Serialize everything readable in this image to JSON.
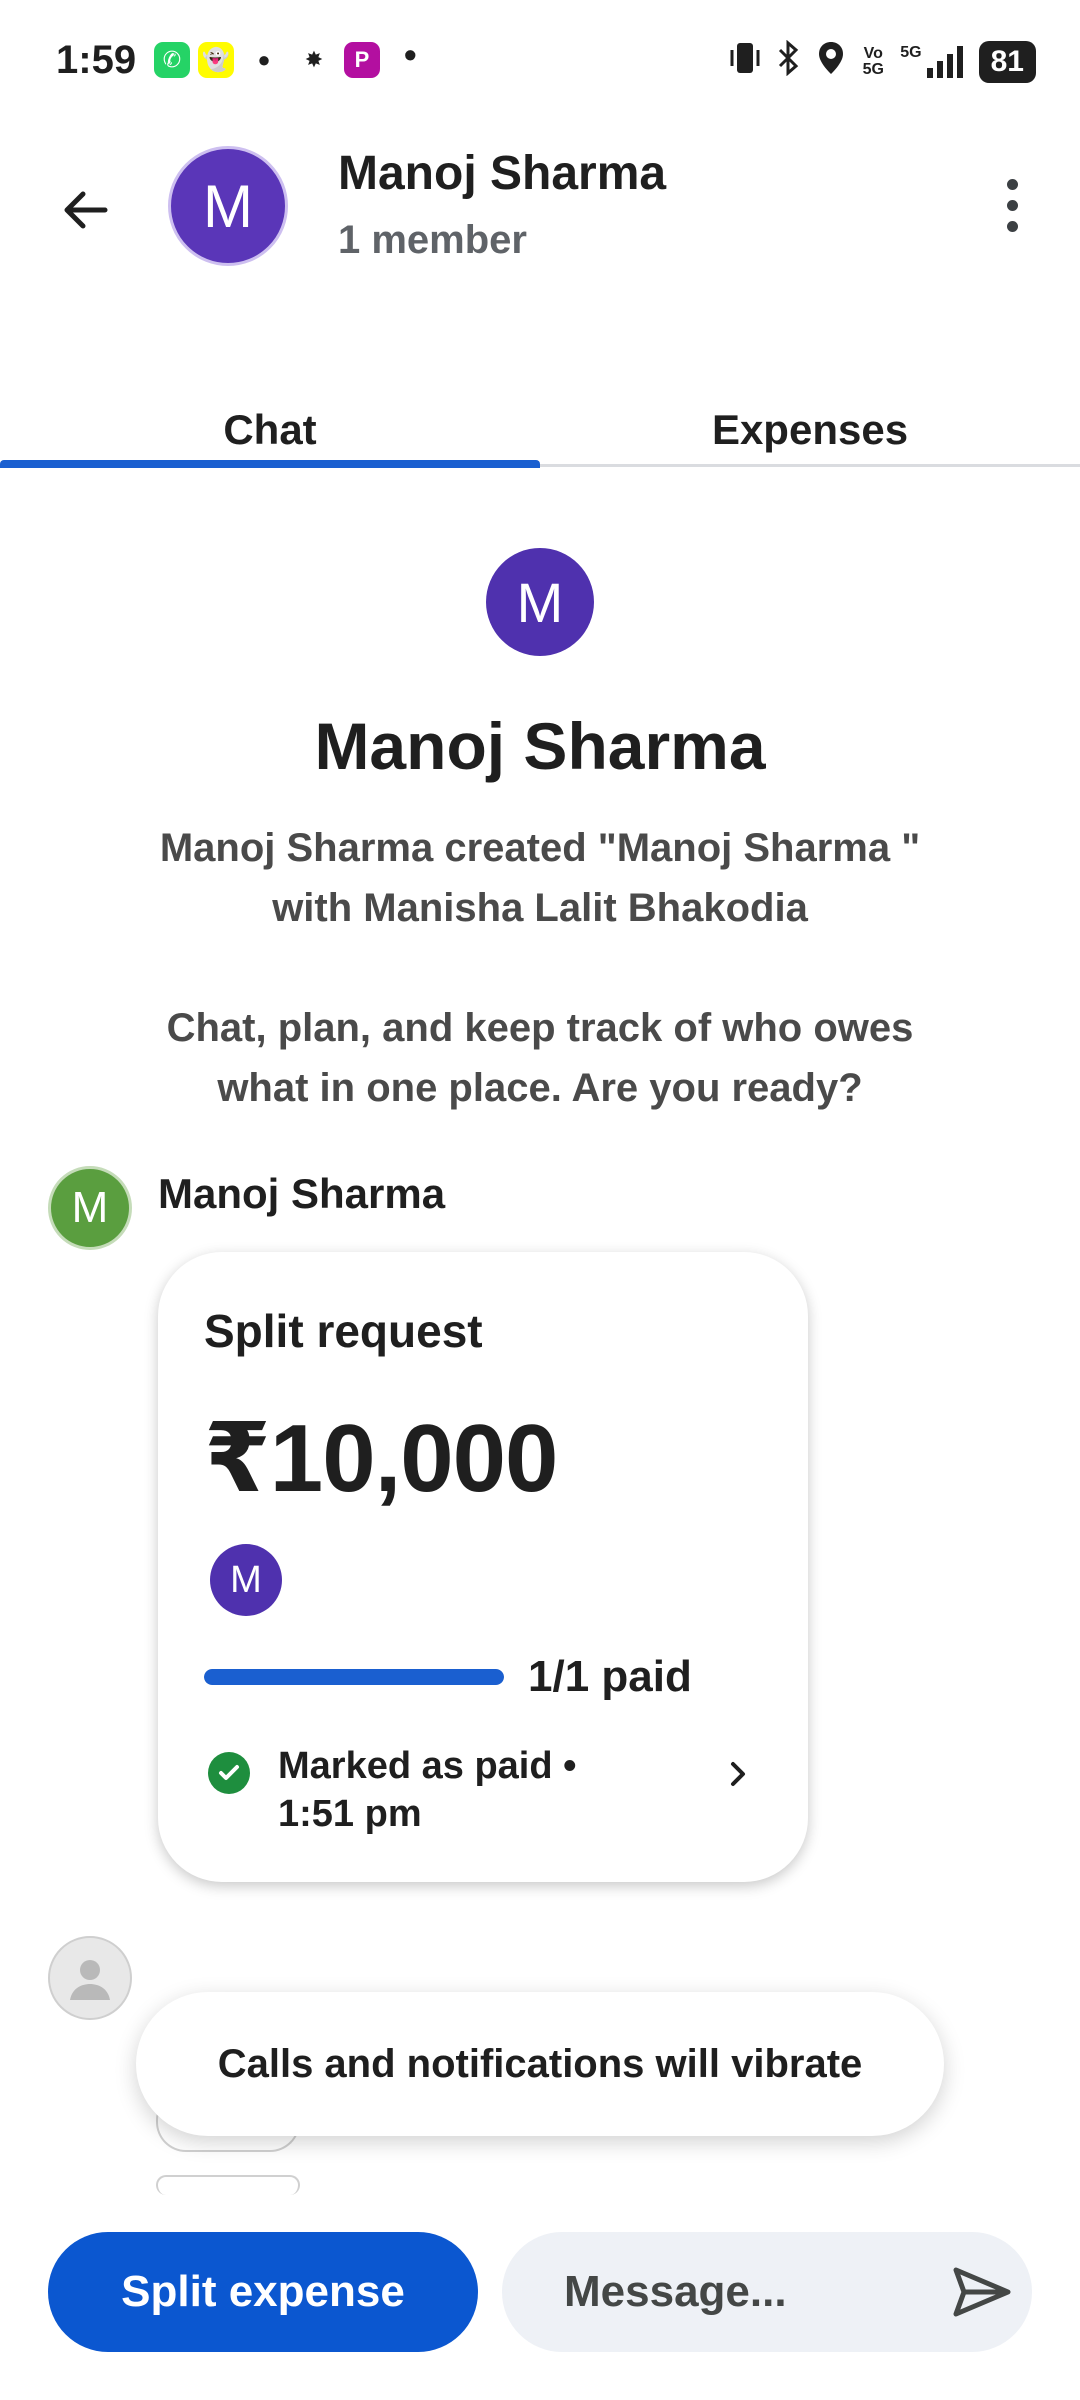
{
  "status_bar": {
    "time": "1:59",
    "apps": [
      {
        "name": "whatsapp-icon",
        "glyph": "✆",
        "bg": "#25d366",
        "fg": "#ffffff"
      },
      {
        "name": "snapchat-icon",
        "glyph": "👻",
        "bg": "#fffc00",
        "fg": "#000000"
      },
      {
        "name": "message-bubble-icon",
        "glyph": "●",
        "bg": "transparent",
        "fg": "#1f1f1f"
      },
      {
        "name": "app-glyph-icon",
        "glyph": "✸",
        "bg": "transparent",
        "fg": "#1f1f1f"
      },
      {
        "name": "p-app-icon",
        "glyph": "P",
        "bg": "#b30fa0",
        "fg": "#ffffff"
      }
    ],
    "more_dot": "•",
    "network": "5G",
    "volte": "Vo 5G",
    "battery": "81"
  },
  "header": {
    "avatar_letter": "M",
    "title": "Manoj Sharma",
    "subtitle": "1 member"
  },
  "tabs": [
    {
      "label": "Chat",
      "active": true
    },
    {
      "label": "Expenses",
      "active": false
    }
  ],
  "intro": {
    "avatar_letter": "M",
    "title": "Manoj Sharma",
    "created_line1": "Manoj Sharma created \"Manoj Sharma \"",
    "created_line2": "with Manisha Lalit Bhakodia",
    "prompt_line1": "Chat, plan, and keep track of who owes",
    "prompt_line2": "what in one place. Are you ready?"
  },
  "message": {
    "sender_letter": "M",
    "sender_name": "Manoj Sharma",
    "card": {
      "title": "Split request",
      "amount": "₹10,000",
      "member_letter": "M",
      "paid_fraction": 1.0,
      "paid_label": "1/1 paid",
      "status_line1": "Marked as paid •",
      "status_line2": "1:51 pm"
    }
  },
  "toast": "Calls and notifications will vibrate",
  "bottom": {
    "split_label": "Split expense",
    "message_placeholder": "Message..."
  },
  "colors": {
    "accent": "#0b57d0",
    "header_avatar": "#5a36b8",
    "sender_avatar": "#5a9e3f",
    "paid_green": "#1e8e3e"
  }
}
